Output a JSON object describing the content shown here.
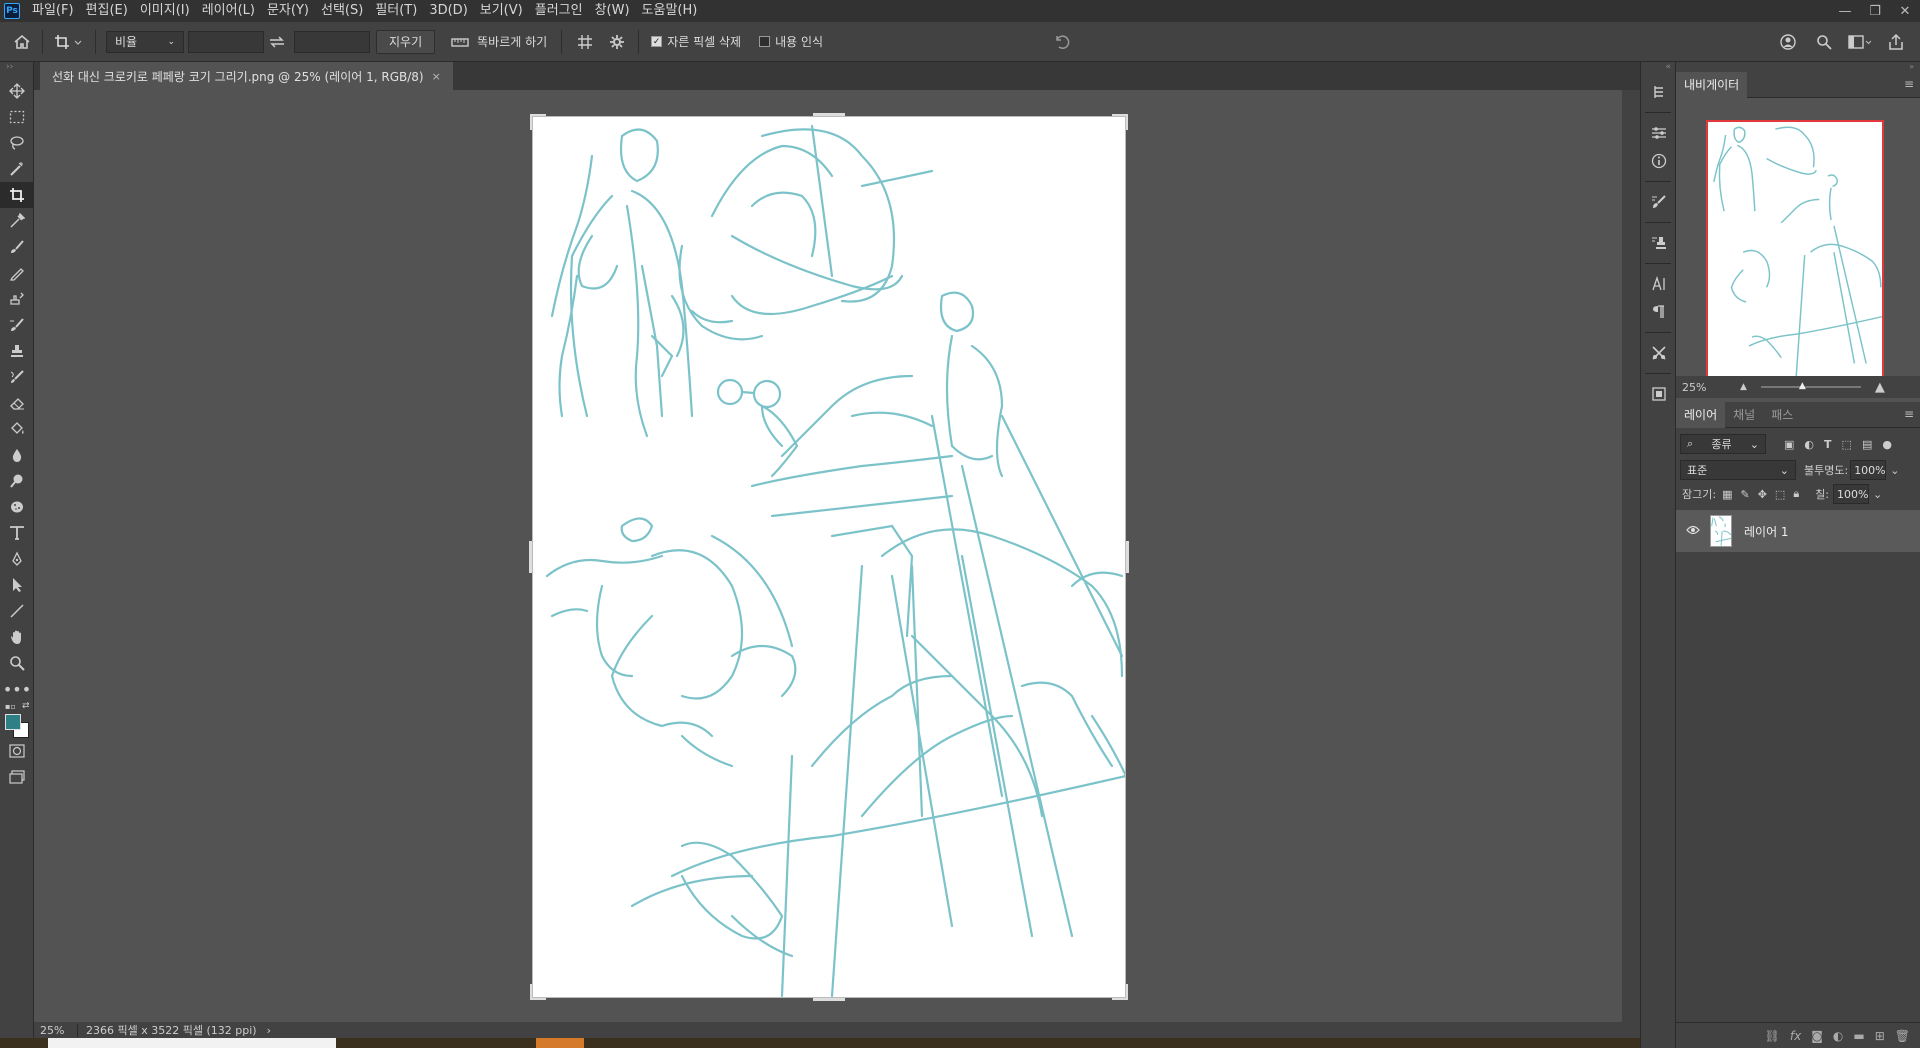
{
  "app": {
    "logo_text": "Ps"
  },
  "menu": [
    "파일(F)",
    "편집(E)",
    "이미지(I)",
    "레이어(L)",
    "문자(Y)",
    "선택(S)",
    "필터(T)",
    "3D(D)",
    "보기(V)",
    "플러그인",
    "창(W)",
    "도움말(H)"
  ],
  "window_controls": {
    "minimize": "—",
    "restore": "❐",
    "close": "✕"
  },
  "options": {
    "ratio_select": "비율",
    "clear_button": "지우기",
    "straighten_label": "똑바르게 하기",
    "delete_cropped_label": "자른 픽셀 삭제",
    "delete_cropped_checked": true,
    "content_aware_label": "내용 인식",
    "content_aware_checked": false
  },
  "document": {
    "tab_title": "선화 대신 크로키로 페페랑 코기 그리기.png @ 25% (레이어 1, RGB/8)",
    "close": "×"
  },
  "status": {
    "zoom": "25%",
    "doc_info": "2366 픽셀 x 3522 픽셀 (132 ppi)",
    "arrow": "›"
  },
  "navigator": {
    "tab": "내비게이터",
    "zoom": "25%"
  },
  "layers_panel": {
    "tabs": [
      "레이어",
      "채널",
      "패스"
    ],
    "filter_select": "종류",
    "blend_mode": "표준",
    "opacity_label": "불투명도:",
    "opacity_value": "100%",
    "lock_label": "잠그기:",
    "fill_label": "칠:",
    "fill_value": "100%",
    "layer_name": "레이어 1"
  },
  "colors": {
    "foreground": "#2e7f86",
    "background": "#ffffff",
    "sketch": "#7cc3c9",
    "navigator_frame": "#e0383b"
  }
}
